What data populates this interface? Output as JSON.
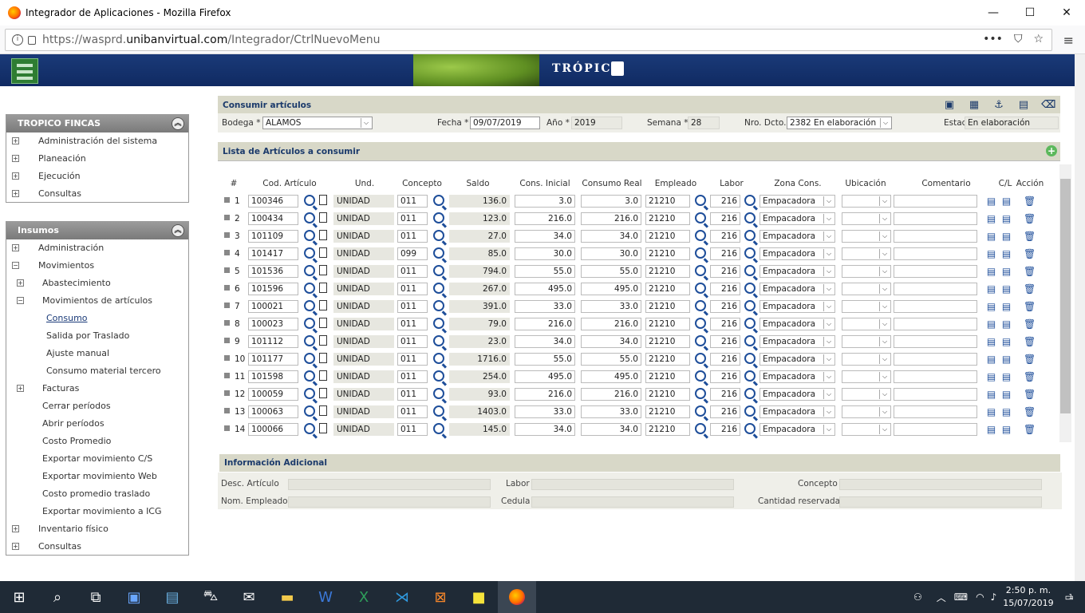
{
  "window": {
    "title": "Integrador de Aplicaciones - Mozilla Firefox",
    "minimize": "—",
    "maximize": "☐",
    "close": "✕"
  },
  "browser": {
    "url_prefix": "https://wasprd.",
    "url_domain": "unibanvirtual.com",
    "url_path": "/Integrador/CtrlNuevoMenu",
    "more_icon": "•••",
    "pocket_icon": "⛉",
    "star_icon": "☆",
    "menu_icon": "≡"
  },
  "banner": {
    "brand": "TRÓPICO"
  },
  "sidebar1": {
    "title": "TROPICO FINCAS",
    "items": [
      {
        "label": "Administración del sistema",
        "exp": "+"
      },
      {
        "label": "Planeación",
        "exp": "+"
      },
      {
        "label": "Ejecución",
        "exp": "+"
      },
      {
        "label": "Consultas",
        "exp": "+"
      }
    ]
  },
  "sidebar2": {
    "title": "Insumos",
    "items": [
      {
        "label": "Administración",
        "exp": "+"
      },
      {
        "label": "Movimientos",
        "exp": "−"
      },
      {
        "label": "Abastecimiento",
        "exp": "+"
      },
      {
        "label": "Movimientos de artículos",
        "exp": "−"
      },
      {
        "label": "Consumo"
      },
      {
        "label": "Salida por Traslado"
      },
      {
        "label": "Ajuste manual"
      },
      {
        "label": "Consumo material tercero"
      },
      {
        "label": "Facturas",
        "exp": "+"
      },
      {
        "label": "Cerrar períodos"
      },
      {
        "label": "Abrir períodos"
      },
      {
        "label": "Costo Promedio"
      },
      {
        "label": "Exportar movimiento C/S"
      },
      {
        "label": "Exportar movimiento Web"
      },
      {
        "label": "Costo promedio traslado"
      },
      {
        "label": "Exportar movimiento a ICG"
      },
      {
        "label": "Inventario físico",
        "exp": "+"
      },
      {
        "label": "Consultas",
        "exp": "+"
      }
    ]
  },
  "form": {
    "title": "Consumir artículos",
    "bodega_label": "Bodega *",
    "bodega_value": "ALAMOS",
    "fecha_label": "Fecha *",
    "fecha_value": "09/07/2019",
    "anio_label": "Año *",
    "anio_value": "2019",
    "semana_label": "Semana *",
    "semana_value": "28",
    "nrodcto_label": "Nro. Dcto.",
    "nrodcto_value": "2382 En elaboración",
    "estado_label": "Estado",
    "estado_value": "En elaboración"
  },
  "list": {
    "title": "Lista de Artículos a consumir",
    "headers": [
      "#",
      "Cod. Artículo",
      "Und.",
      "Concepto",
      "Saldo",
      "Cons. Inicial",
      "Consumo Real",
      "Empleado",
      "Labor",
      "Zona Cons.",
      "Ubicación",
      "Comentario",
      "C/L",
      "Acción"
    ],
    "rows": [
      {
        "n": "1",
        "cod": "100346",
        "und": "UNIDAD",
        "con": "011",
        "saldo": "136.0",
        "ini": "3.0",
        "real": "3.0",
        "emp": "21210",
        "lab": "216",
        "zona": "Empacadora"
      },
      {
        "n": "2",
        "cod": "100434",
        "und": "UNIDAD",
        "con": "011",
        "saldo": "123.0",
        "ini": "216.0",
        "real": "216.0",
        "emp": "21210",
        "lab": "216",
        "zona": "Empacadora"
      },
      {
        "n": "3",
        "cod": "101109",
        "und": "UNIDAD",
        "con": "011",
        "saldo": "27.0",
        "ini": "34.0",
        "real": "34.0",
        "emp": "21210",
        "lab": "216",
        "zona": "Empacadora"
      },
      {
        "n": "4",
        "cod": "101417",
        "und": "UNIDAD",
        "con": "099",
        "saldo": "85.0",
        "ini": "30.0",
        "real": "30.0",
        "emp": "21210",
        "lab": "216",
        "zona": "Empacadora"
      },
      {
        "n": "5",
        "cod": "101536",
        "und": "UNIDAD",
        "con": "011",
        "saldo": "794.0",
        "ini": "55.0",
        "real": "55.0",
        "emp": "21210",
        "lab": "216",
        "zona": "Empacadora"
      },
      {
        "n": "6",
        "cod": "101596",
        "und": "UNIDAD",
        "con": "011",
        "saldo": "267.0",
        "ini": "495.0",
        "real": "495.0",
        "emp": "21210",
        "lab": "216",
        "zona": "Empacadora"
      },
      {
        "n": "7",
        "cod": "100021",
        "und": "UNIDAD",
        "con": "011",
        "saldo": "391.0",
        "ini": "33.0",
        "real": "33.0",
        "emp": "21210",
        "lab": "216",
        "zona": "Empacadora"
      },
      {
        "n": "8",
        "cod": "100023",
        "und": "UNIDAD",
        "con": "011",
        "saldo": "79.0",
        "ini": "216.0",
        "real": "216.0",
        "emp": "21210",
        "lab": "216",
        "zona": "Empacadora"
      },
      {
        "n": "9",
        "cod": "101112",
        "und": "UNIDAD",
        "con": "011",
        "saldo": "23.0",
        "ini": "34.0",
        "real": "34.0",
        "emp": "21210",
        "lab": "216",
        "zona": "Empacadora"
      },
      {
        "n": "10",
        "cod": "101177",
        "und": "UNIDAD",
        "con": "011",
        "saldo": "1716.0",
        "ini": "55.0",
        "real": "55.0",
        "emp": "21210",
        "lab": "216",
        "zona": "Empacadora"
      },
      {
        "n": "11",
        "cod": "101598",
        "und": "UNIDAD",
        "con": "011",
        "saldo": "254.0",
        "ini": "495.0",
        "real": "495.0",
        "emp": "21210",
        "lab": "216",
        "zona": "Empacadora"
      },
      {
        "n": "12",
        "cod": "100059",
        "und": "UNIDAD",
        "con": "011",
        "saldo": "93.0",
        "ini": "216.0",
        "real": "216.0",
        "emp": "21210",
        "lab": "216",
        "zona": "Empacadora"
      },
      {
        "n": "13",
        "cod": "100063",
        "und": "UNIDAD",
        "con": "011",
        "saldo": "1403.0",
        "ini": "33.0",
        "real": "33.0",
        "emp": "21210",
        "lab": "216",
        "zona": "Empacadora"
      },
      {
        "n": "14",
        "cod": "100066",
        "und": "UNIDAD",
        "con": "011",
        "saldo": "145.0",
        "ini": "34.0",
        "real": "34.0",
        "emp": "21210",
        "lab": "216",
        "zona": "Empacadora"
      }
    ]
  },
  "info": {
    "title": "Información Adicional",
    "desc_label": "Desc. Artículo",
    "labor_label": "Labor",
    "concepto_label": "Concepto",
    "emp_label": "Nom. Empleado",
    "cedula_label": "Cedula",
    "cant_label": "Cantidad reservada"
  },
  "taskbar": {
    "time": "2:50 p. m.",
    "date": "15/07/2019",
    "notif_count": "1"
  }
}
